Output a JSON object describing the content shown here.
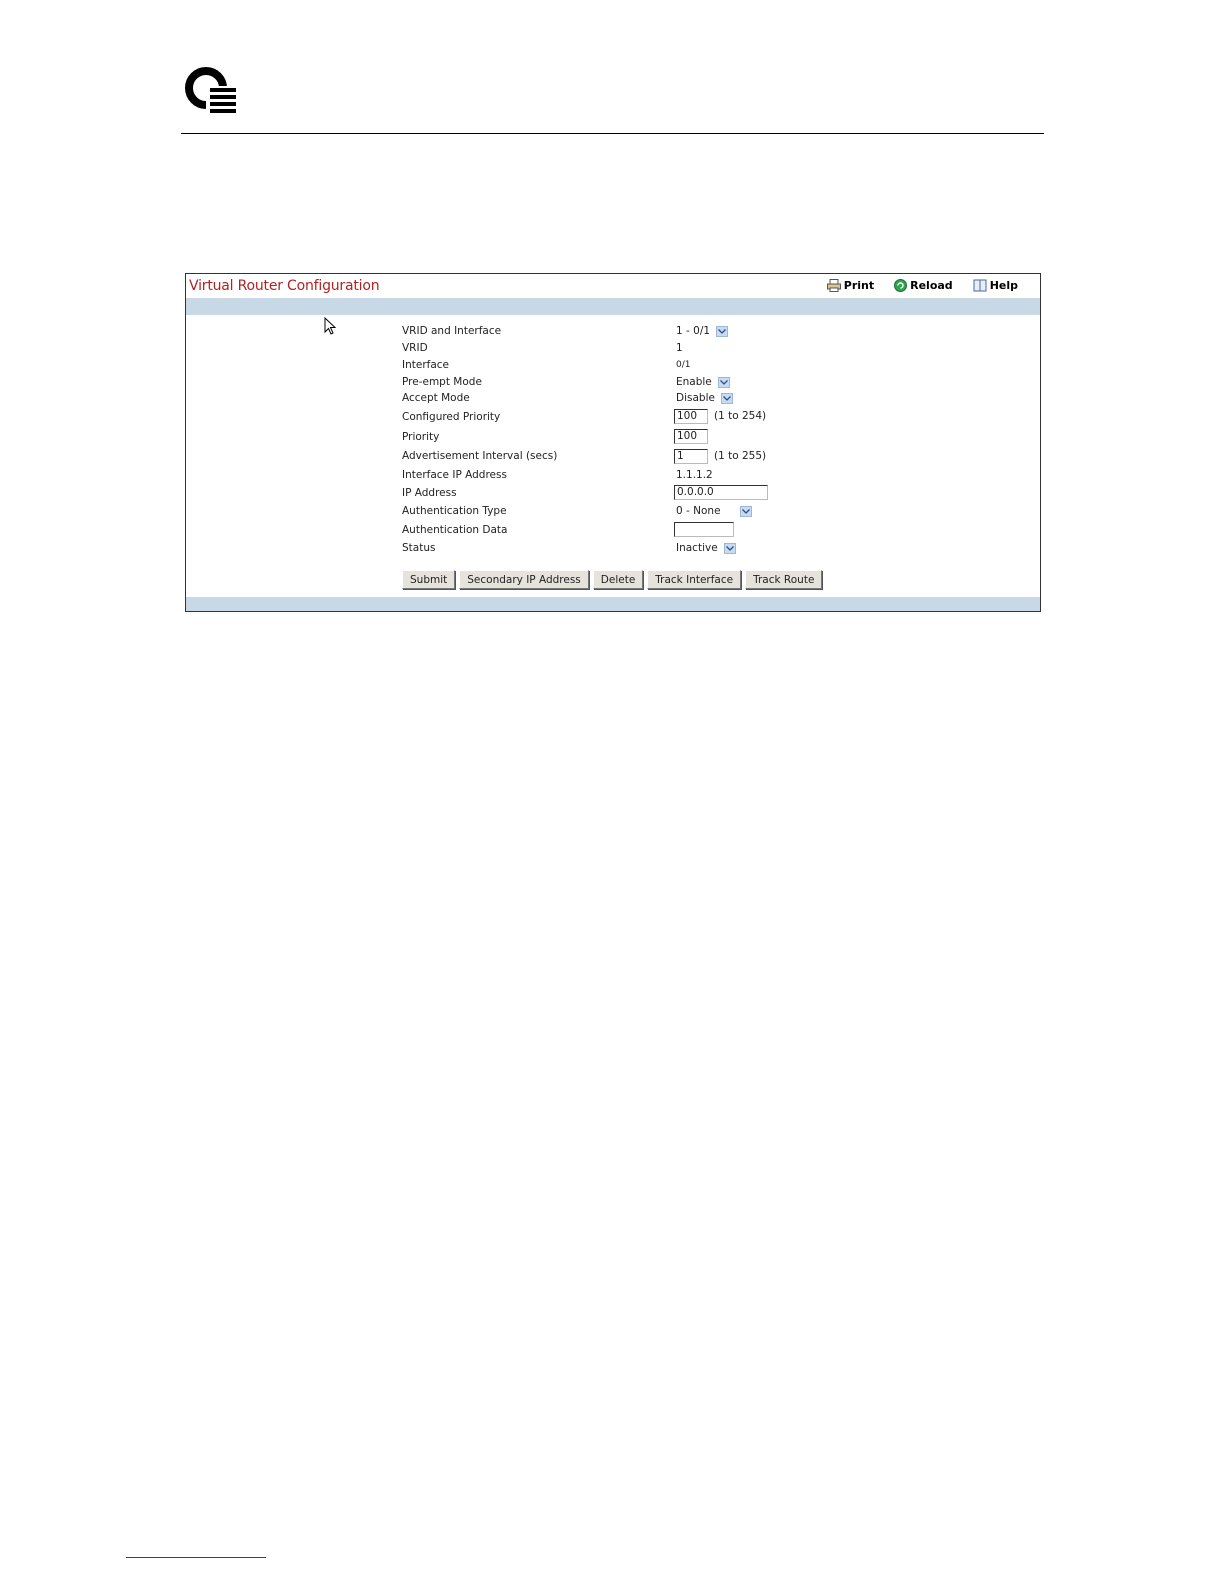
{
  "panel": {
    "title": "Virtual Router Configuration",
    "toolbar": {
      "print": "Print",
      "reload": "Reload",
      "help": "Help"
    }
  },
  "form": {
    "vrid_and_interface": {
      "label": "VRID and Interface",
      "value": "1 - 0/1"
    },
    "vrid": {
      "label": "VRID",
      "value": "1"
    },
    "interface": {
      "label": "Interface",
      "value": "0/1"
    },
    "preempt_mode": {
      "label": "Pre-empt Mode",
      "value": "Enable"
    },
    "accept_mode": {
      "label": "Accept Mode",
      "value": "Disable"
    },
    "configured_priority": {
      "label": "Configured Priority",
      "value": "100",
      "range": "(1 to 254)"
    },
    "priority": {
      "label": "Priority",
      "value": "100"
    },
    "advertisement_interval": {
      "label": "Advertisement Interval (secs)",
      "value": "1",
      "range": "(1 to 255)"
    },
    "interface_ip": {
      "label": "Interface IP Address",
      "value": "1.1.1.2"
    },
    "ip_address": {
      "label": "IP Address",
      "value": "0.0.0.0"
    },
    "auth_type": {
      "label": "Authentication Type",
      "value": "0 - None"
    },
    "auth_data": {
      "label": "Authentication Data",
      "value": ""
    },
    "status": {
      "label": "Status",
      "value": "Inactive"
    }
  },
  "buttons": {
    "submit": "Submit",
    "secondary_ip": "Secondary IP Address",
    "delete": "Delete",
    "track_interface": "Track Interface",
    "track_route": "Track Route"
  },
  "colors": {
    "title": "#b22222",
    "band": "#c8d8e4",
    "dropdown": "#c9dbf0"
  },
  "icons": [
    "logo-icon",
    "printer-icon",
    "reload-icon",
    "help-book-icon",
    "chevron-down-icon",
    "mouse-cursor-icon"
  ]
}
